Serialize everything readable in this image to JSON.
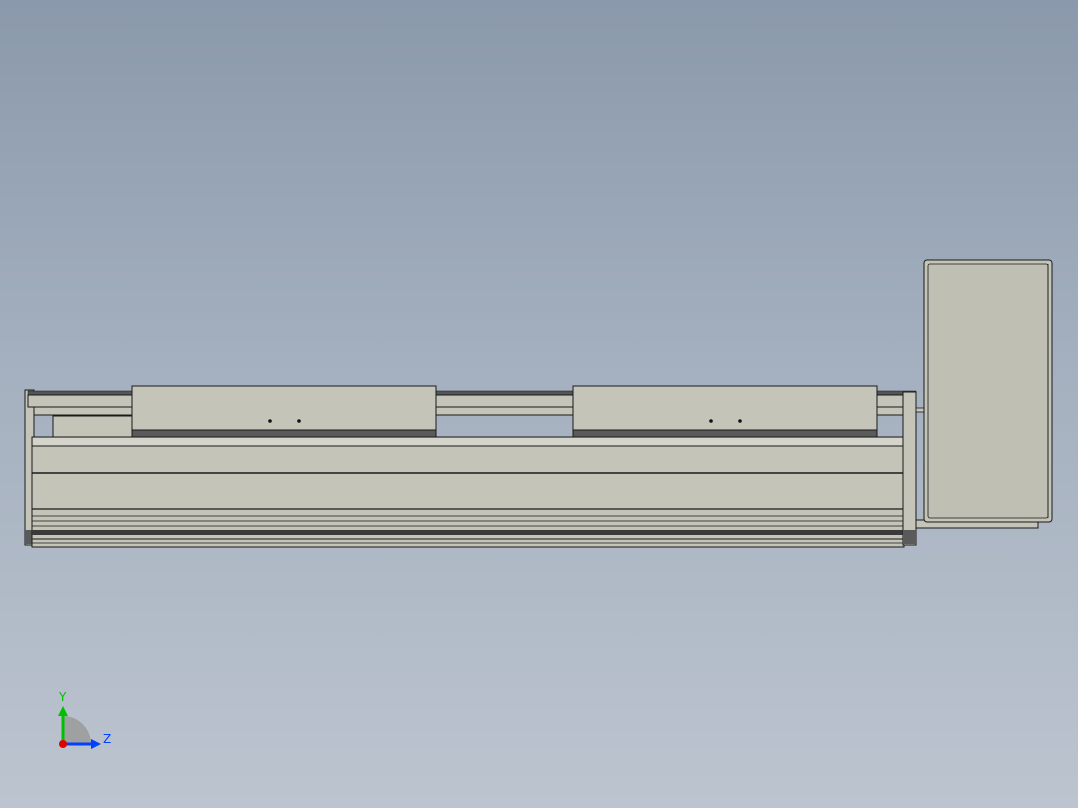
{
  "viewport": {
    "background_top": "#8a99ab",
    "background_bottom": "#bcc4cf",
    "part_fill": "#c4c4b8",
    "part_edge": "#1a1a1a",
    "rail_dark": "#404040"
  },
  "model": {
    "components": [
      "linear-actuator-body",
      "carriage-left",
      "carriage-right",
      "motor-housing"
    ]
  },
  "triad": {
    "y_label": "Y",
    "z_label": "Z",
    "y_color": "#00c000",
    "z_color": "#0040ff",
    "origin_color": "#e00000"
  }
}
